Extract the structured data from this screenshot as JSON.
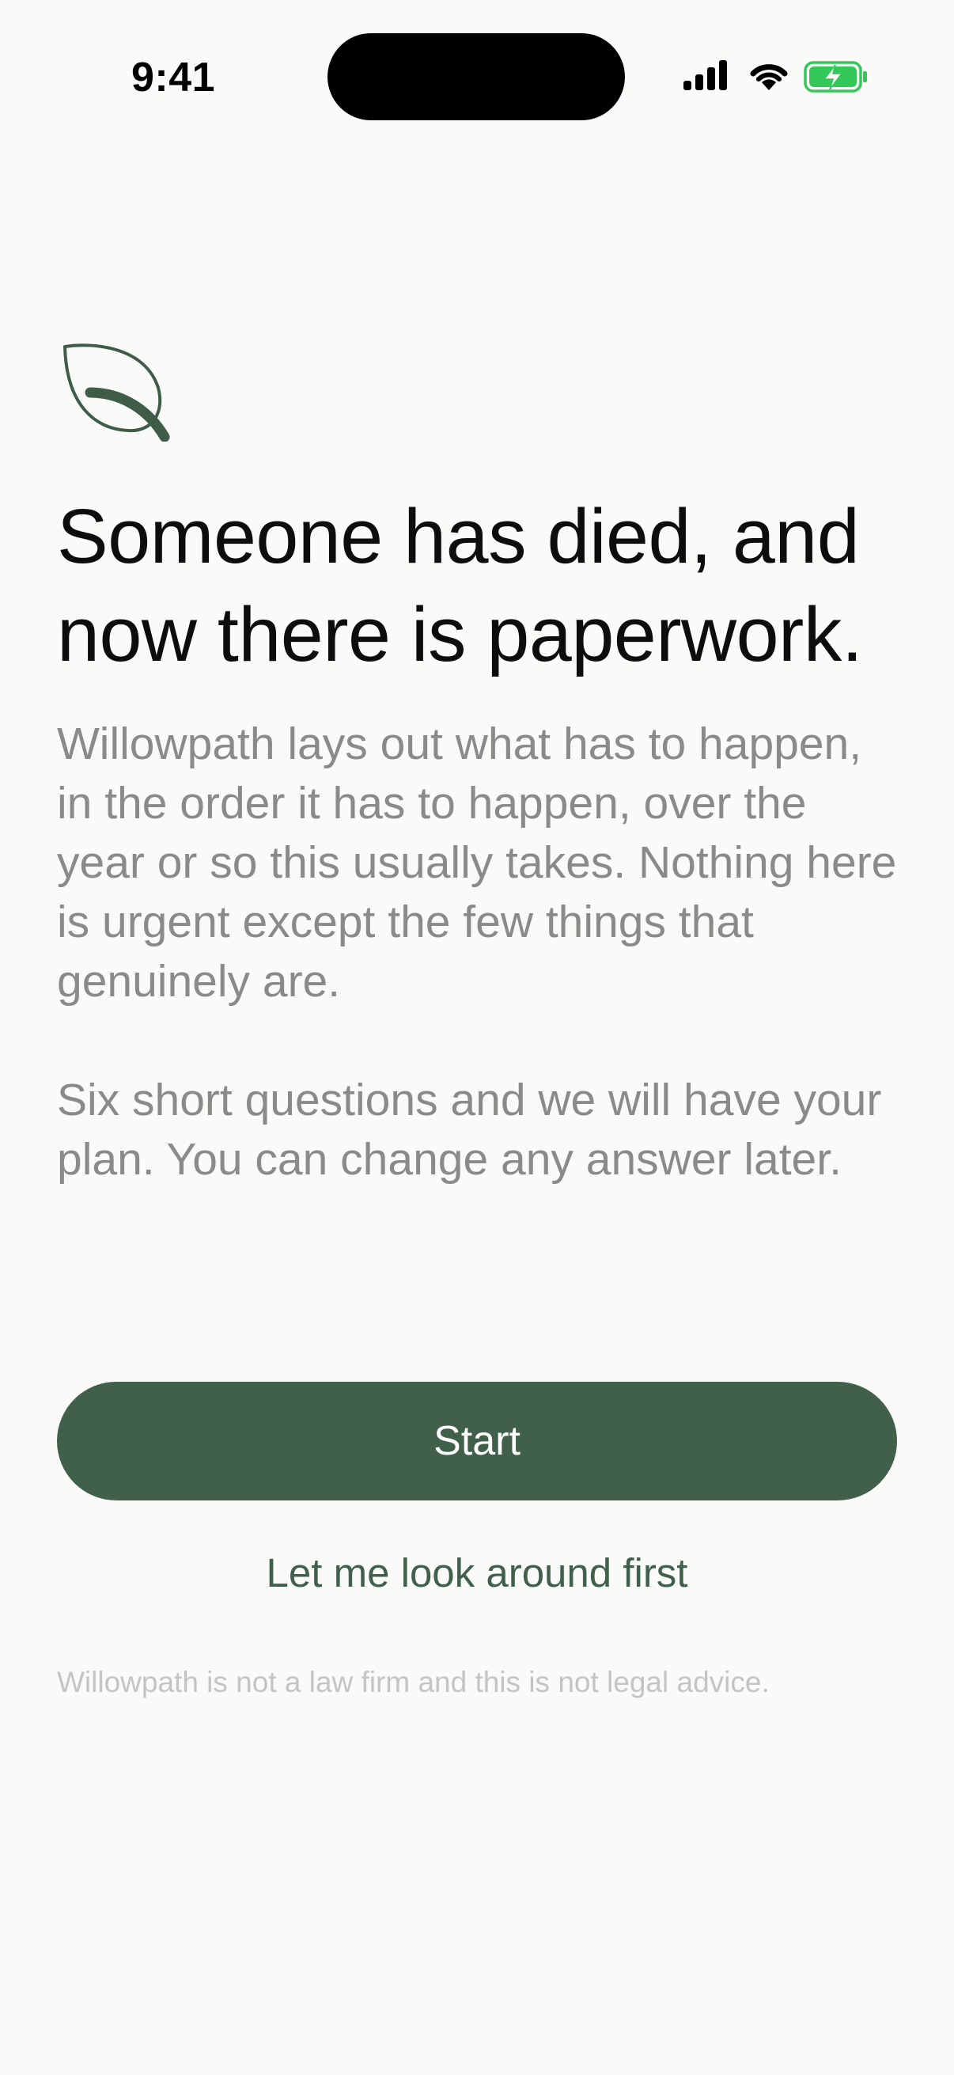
{
  "status_bar": {
    "time": "9:41"
  },
  "colors": {
    "accent": "#41604b",
    "background": "#fafaf8",
    "body_text": "#8a8a88",
    "disclaimer_text": "#c4c4c2",
    "battery_fill": "#34c759"
  },
  "icons": {
    "brand": "leaf-icon",
    "status": [
      "cellular-signal-icon",
      "wifi-icon",
      "battery-charging-icon"
    ]
  },
  "onboarding": {
    "headline": "Someone has died, and now there is paperwork.",
    "body_paragraph_1": "Willowpath lays out what has to happen, in the order it has to happen, over the year or so this usually takes. Nothing here is urgent except the few things that genuinely are.",
    "body_paragraph_2": "Six short questions and we will have your plan. You can change any answer later.",
    "start_label": "Start",
    "secondary_label": "Let me look around first",
    "disclaimer": "Willowpath is not a law firm and this is not legal advice."
  }
}
